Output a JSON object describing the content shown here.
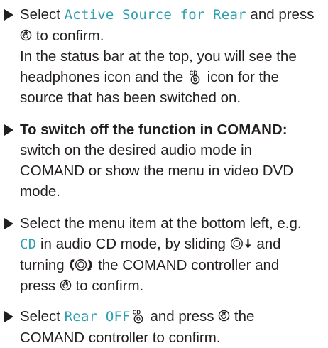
{
  "steps": [
    {
      "lines": {
        "a": "Select ",
        "b": "Active Source for Rear",
        "c": " and press ",
        "d": " to confirm.",
        "e": "In the status bar at the top, you will see the headphones icon and the ",
        "f": " icon for the source that has been switched on."
      }
    },
    {
      "lines": {
        "a": "To switch off the function in COMAND:",
        "b": " switch on the desired audio mode in COMAND or show the menu in video DVD mode."
      }
    },
    {
      "lines": {
        "a": "Select the menu item at the bottom left, e.g. ",
        "b": "CD",
        "c": " in audio CD mode, by sliding ",
        "d": " and turning ",
        "e": " the COMAND controller and press ",
        "f": " to confirm."
      }
    },
    {
      "lines": {
        "a": "Select ",
        "b": "Rear OFF",
        "c": " and press ",
        "d": " the COMAND controller to confirm."
      }
    }
  ],
  "icons": {
    "press": "press-controller-icon",
    "cd": "cd-source-icon",
    "slide_down": "slide-down-controller-icon",
    "turn": "turn-controller-icon",
    "color_highlight": "#2e9fb0"
  }
}
